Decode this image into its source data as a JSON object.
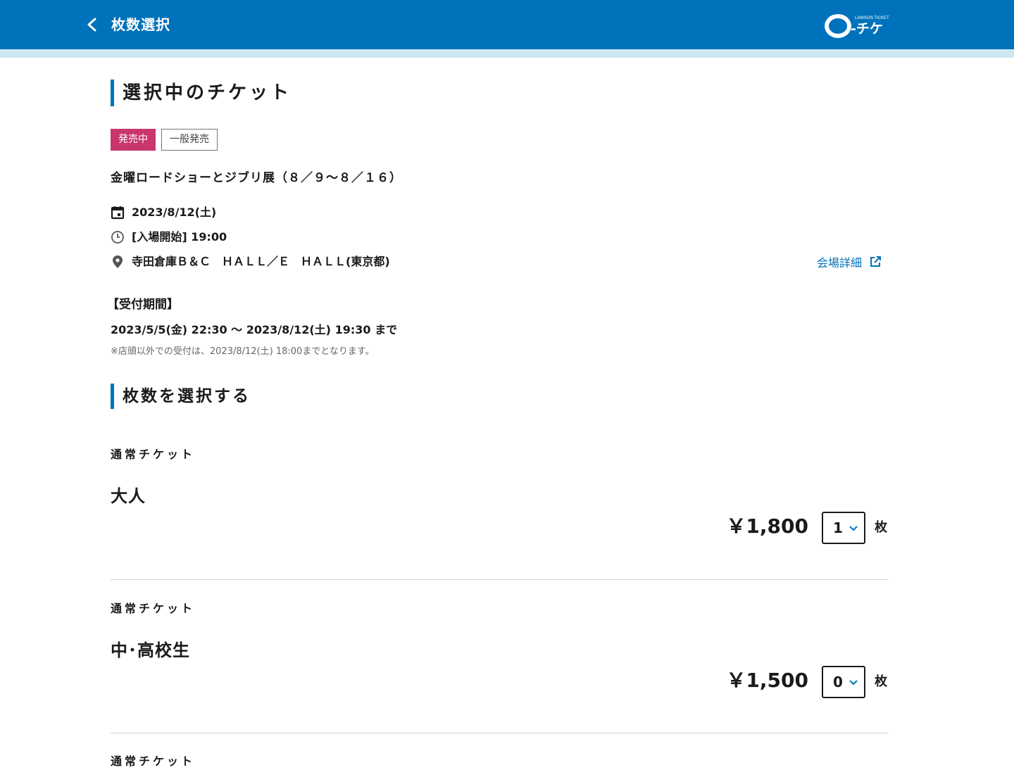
{
  "header": {
    "title": "枚数選択",
    "logo": {
      "small": "LAWSON TICKET",
      "kana": "-チケ"
    },
    "color": "#0072bb"
  },
  "selected": {
    "heading": "選択中のチケット",
    "badges": {
      "onsale": "発売中",
      "general": "一般発売"
    },
    "event_title": "金曜ロードショーとジブリ展（８／９～８／１６）",
    "date": "2023/8/12(土)",
    "time": "[入場開始] 19:00",
    "venue": "寺田倉庫Ｂ＆Ｃ　ＨＡＬＬ／Ｅ　ＨＡＬＬ(東京都)",
    "venue_detail": "会場詳細",
    "period_label": "【受付期間】",
    "period": "2023/5/5(金) 22:30 ～ 2023/8/12(土) 19:30 まで",
    "period_note": "※店頭以外での受付は、2023/8/12(土) 18:00までとなります。"
  },
  "quantity": {
    "heading": "枚数を選択する",
    "unit": "枚",
    "tickets": [
      {
        "kind": "通常チケット",
        "name": "大人",
        "price": "￥1,800",
        "qty": "1"
      },
      {
        "kind": "通常チケット",
        "name": "中･高校生",
        "price": "￥1,500",
        "qty": "0"
      },
      {
        "kind": "通常チケット"
      }
    ]
  },
  "colors": {
    "accent": "#0072bb",
    "badge_onsale": "#c9356d",
    "header_band": "#cfe6f5"
  }
}
